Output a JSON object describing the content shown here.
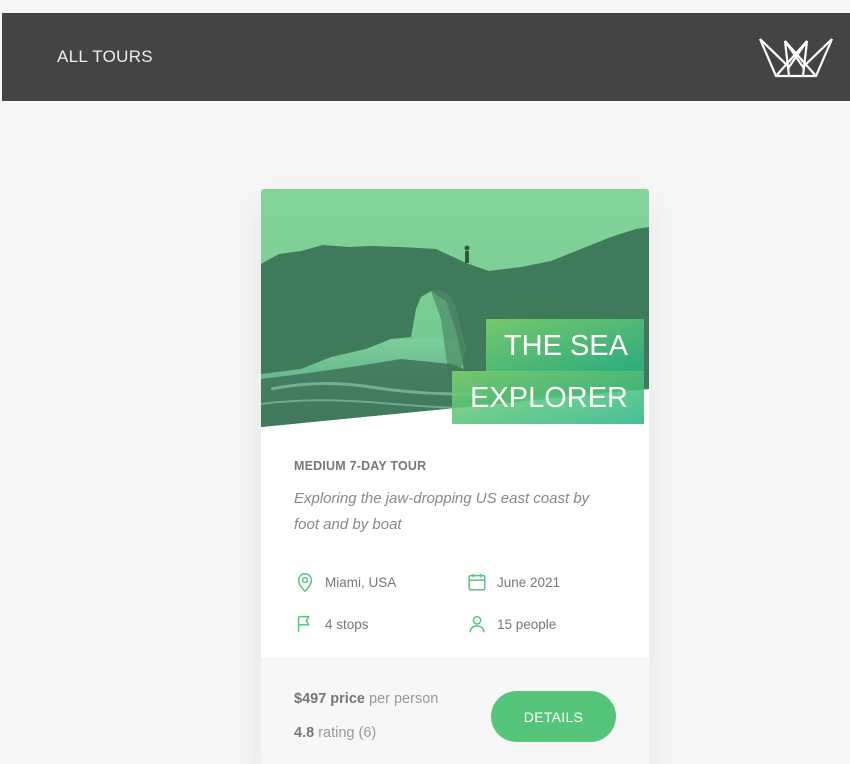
{
  "header": {
    "nav_link": "ALL TOURS",
    "logo_icon": "crown-logo-icon"
  },
  "tour": {
    "title_line1": "THE SEA",
    "title_line2": "EXPLORER",
    "picture": "green-tinted-sea-arch-photo",
    "sub_heading": "MEDIUM 7-DAY TOUR",
    "summary": "Exploring the jaw-dropping US east coast by foot and by boat",
    "data": [
      {
        "icon": "map-pin-icon",
        "text": "Miami, USA"
      },
      {
        "icon": "calendar-icon",
        "text": "June 2021"
      },
      {
        "icon": "flag-icon",
        "text": "4 stops"
      },
      {
        "icon": "user-icon",
        "text": "15 people"
      }
    ],
    "price_value": "$497",
    "price_word": "price",
    "price_suffix": "per person",
    "rating_value": "4.8",
    "rating_word": "rating",
    "rating_count": "(6)",
    "details_button": "DETAILS"
  },
  "colors": {
    "header_bg": "#444444",
    "accent_green": "#55c57a",
    "page_bg": "#f7f7f7"
  }
}
